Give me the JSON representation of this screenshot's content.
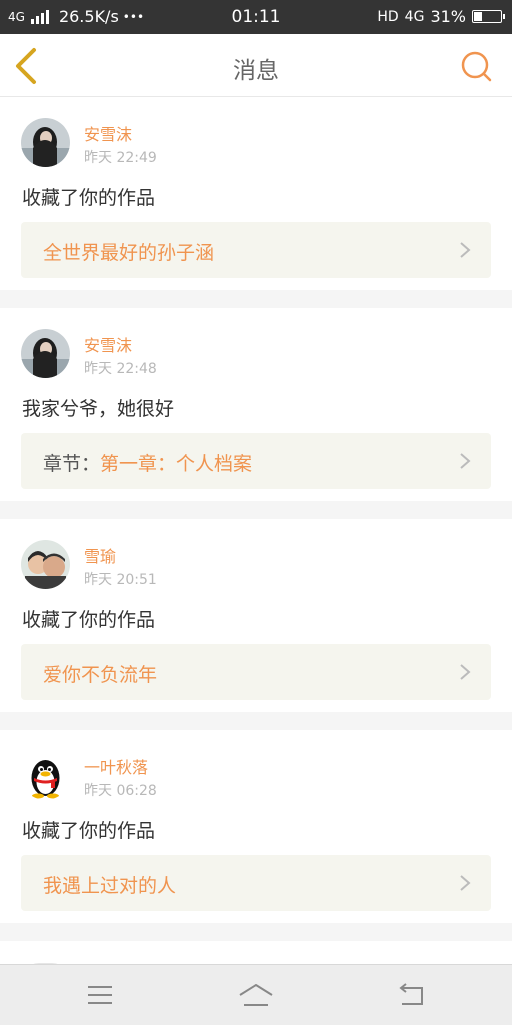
{
  "status_bar": {
    "network": "4G",
    "speed": "26.5K/s",
    "more": "•••",
    "time": "01:11",
    "hd": "HD",
    "net_right": "4G",
    "battery": "31%",
    "battery_level": 0.31
  },
  "header": {
    "back_icon": "chevron-left-icon",
    "title": "消息",
    "search_icon": "search-icon"
  },
  "messages": [
    {
      "name": "安雪沫",
      "time": "昨天 22:49",
      "action": "收藏了你的作品",
      "ref_prefix": "",
      "ref": "全世界最好的孙子涵",
      "avatar": "dark"
    },
    {
      "name": "安雪沫",
      "time": "昨天 22:48",
      "action": "我家兮爷，她很好",
      "ref_prefix": "章节：",
      "ref": "第一章：个人档案",
      "avatar": "dark"
    },
    {
      "name": "雪瑜",
      "time": "昨天 20:51",
      "action": "收藏了你的作品",
      "ref_prefix": "",
      "ref": "爱你不负流年",
      "avatar": "couple"
    },
    {
      "name": "一叶秋落",
      "time": "昨天 06:28",
      "action": "收藏了你的作品",
      "ref_prefix": "",
      "ref": "我遇上过对的人",
      "avatar": "penguin"
    }
  ],
  "colors": {
    "accent": "#f0944f",
    "back_icon": "#d6a520",
    "ref_bg": "#f5f5ee"
  },
  "bottom_nav": {
    "menu_icon": "menu-icon",
    "home_icon": "home-icon",
    "back_icon": "back-icon"
  }
}
